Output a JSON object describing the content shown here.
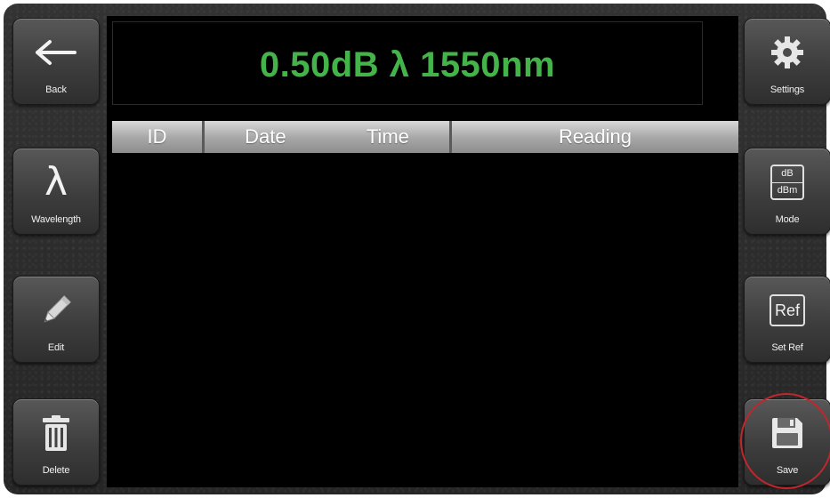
{
  "left_buttons": {
    "back": {
      "label": "Back",
      "icon": "arrow-left-icon"
    },
    "wavelength": {
      "label": "Wavelength",
      "icon": "lambda-icon",
      "glyph": "λ"
    },
    "edit": {
      "label": "Edit",
      "icon": "pencil-icon"
    },
    "delete": {
      "label": "Delete",
      "icon": "trash-icon"
    }
  },
  "right_buttons": {
    "settings": {
      "label": "Settings",
      "icon": "gear-icon"
    },
    "mode": {
      "label": "Mode",
      "icon": "db-dbm-icon",
      "top_text": "dB",
      "bottom_text": "dBm"
    },
    "set_ref": {
      "label": "Set Ref",
      "icon": "ref-icon",
      "icon_text": "Ref"
    },
    "save": {
      "label": "Save",
      "icon": "floppy-disk-icon",
      "highlighted": true
    }
  },
  "display": {
    "reading": "0.50dB λ 1550nm",
    "color": "#44b34a"
  },
  "table": {
    "columns": [
      "ID",
      "Date",
      "Time",
      "Reading"
    ],
    "rows": []
  },
  "colors": {
    "reading_green": "#44b34a",
    "highlight_ring": "#c0262c"
  }
}
